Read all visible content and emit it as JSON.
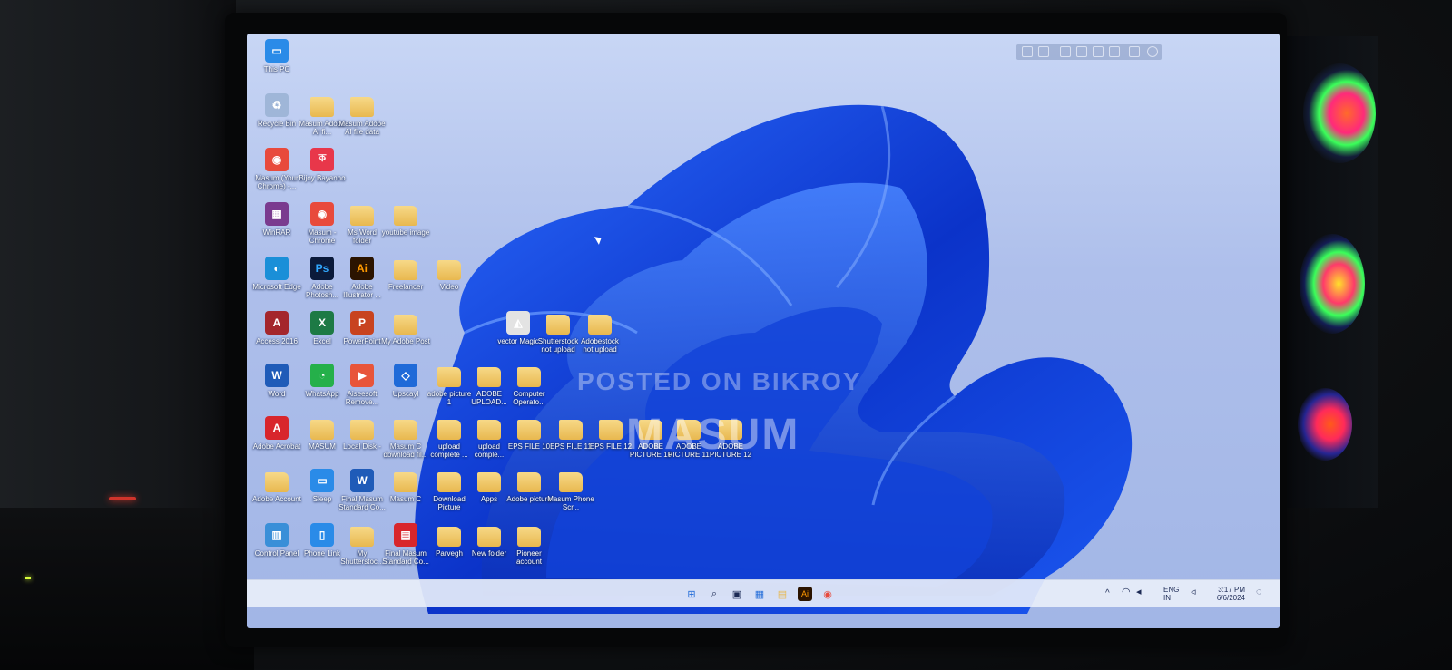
{
  "desktop": {
    "icons": [
      {
        "label": "This PC",
        "icon": "monitor-icon",
        "color": "#2a8be8"
      },
      {
        "label": "Recycle Bin",
        "icon": "recycle-bin-icon",
        "color": "#9fb6d8"
      },
      {
        "label": "Masum Adobe AI fi...",
        "icon": "folder-icon",
        "color": "#e8b84f"
      },
      {
        "label": "Masum Adobe AI file data",
        "icon": "folder-icon",
        "color": "#e8b84f"
      },
      {
        "label": "Masum (Your Chrome) -...",
        "icon": "chrome-icon",
        "color": "#e84a3c"
      },
      {
        "label": "Bijoy Bayanno",
        "icon": "bijoy-icon",
        "color": "#e8374a"
      },
      {
        "label": "WinRAR",
        "icon": "winrar-icon",
        "color": "#7a3b8f"
      },
      {
        "label": "Masum - Chrome",
        "icon": "chrome-icon",
        "color": "#e84a3c"
      },
      {
        "label": "Ms Word folder",
        "icon": "folder-icon",
        "color": "#e8b84f"
      },
      {
        "label": "youtube image",
        "icon": "folder-icon",
        "color": "#e8b84f"
      },
      {
        "label": "Microsoft Edge",
        "icon": "edge-icon",
        "color": "#1a8fd8"
      },
      {
        "label": "Adobe Photosh...",
        "icon": "photoshop-icon",
        "color": "#0b1a3a"
      },
      {
        "label": "Adobe Illustrator ...",
        "icon": "illustrator-icon",
        "color": "#2b1400"
      },
      {
        "label": "Freelancer",
        "icon": "folder-icon",
        "color": "#e8b84f"
      },
      {
        "label": "Video",
        "icon": "folder-icon",
        "color": "#e8b84f"
      },
      {
        "label": "Access 2016",
        "icon": "access-icon",
        "color": "#a4262c"
      },
      {
        "label": "Excel",
        "icon": "excel-icon",
        "color": "#1d7a45"
      },
      {
        "label": "PowerPoint",
        "icon": "powerpoint-icon",
        "color": "#c8431f"
      },
      {
        "label": "My Adobe Post",
        "icon": "folder-icon",
        "color": "#e8b84f"
      },
      {
        "label": "vector Magic",
        "icon": "vector-magic-icon",
        "color": "#e3e3e3"
      },
      {
        "label": "Shutterstock not upload",
        "icon": "folder-icon",
        "color": "#e8b84f"
      },
      {
        "label": "Adobestock not upload",
        "icon": "folder-icon",
        "color": "#e8b84f"
      },
      {
        "label": "Word",
        "icon": "word-icon",
        "color": "#1f5bb8"
      },
      {
        "label": "WhatsApp",
        "icon": "whatsapp-icon",
        "color": "#25b04a"
      },
      {
        "label": "Aiseesoft Remove...",
        "icon": "aiseesoft-icon",
        "color": "#e8553a"
      },
      {
        "label": "Upscayl",
        "icon": "upscayl-icon",
        "color": "#1f6ad8"
      },
      {
        "label": "adobe picture 1",
        "icon": "folder-icon",
        "color": "#e8b84f"
      },
      {
        "label": "ADOBE UPLOAD...",
        "icon": "folder-icon",
        "color": "#e8b84f"
      },
      {
        "label": "Computer Operato...",
        "icon": "folder-icon",
        "color": "#e8b84f"
      },
      {
        "label": "Adobe Acrobat",
        "icon": "acrobat-icon",
        "color": "#d8262c"
      },
      {
        "label": "MASUM",
        "icon": "folder-icon",
        "color": "#e8b84f"
      },
      {
        "label": "Local Disk -",
        "icon": "folder-icon",
        "color": "#e8b84f"
      },
      {
        "label": "Masum C download fil...",
        "icon": "folder-icon",
        "color": "#e8b84f"
      },
      {
        "label": "upload complete ...",
        "icon": "folder-icon",
        "color": "#e8b84f"
      },
      {
        "label": "upload comple...",
        "icon": "folder-icon",
        "color": "#e8b84f"
      },
      {
        "label": "EPS FILE 10",
        "icon": "folder-icon",
        "color": "#e8b84f"
      },
      {
        "label": "EPS FILE 11",
        "icon": "folder-icon",
        "color": "#e8b84f"
      },
      {
        "label": "EPS FILE 12",
        "icon": "folder-icon",
        "color": "#e8b84f"
      },
      {
        "label": "ADOBE PICTURE 10",
        "icon": "folder-icon",
        "color": "#e8b84f"
      },
      {
        "label": "ADOBE PICTURE 11",
        "icon": "folder-icon",
        "color": "#e8b84f"
      },
      {
        "label": "ADOBE PICTURE 12",
        "icon": "folder-icon",
        "color": "#e8b84f"
      },
      {
        "label": "Adobe Account",
        "icon": "folder-icon",
        "color": "#e8b84f"
      },
      {
        "label": "Sleep",
        "icon": "monitor-icon",
        "color": "#2a8be8"
      },
      {
        "label": "Final Masum Standard Co...",
        "icon": "word-doc-icon",
        "color": "#1f5bb8"
      },
      {
        "label": "Masum C",
        "icon": "folder-icon",
        "color": "#e8b84f"
      },
      {
        "label": "Download Picture",
        "icon": "folder-icon",
        "color": "#e8b84f"
      },
      {
        "label": "Apps",
        "icon": "folder-icon",
        "color": "#e8b84f"
      },
      {
        "label": "Adobe picture",
        "icon": "folder-icon",
        "color": "#e8b84f"
      },
      {
        "label": "Masum Phone Scr...",
        "icon": "folder-icon",
        "color": "#e8b84f"
      },
      {
        "label": "Control Panel",
        "icon": "control-panel-icon",
        "color": "#3a8fd8"
      },
      {
        "label": "Phone Link",
        "icon": "phone-link-icon",
        "color": "#2a8be8"
      },
      {
        "label": "My Shutterstoc...",
        "icon": "folder-icon",
        "color": "#e8b84f"
      },
      {
        "label": "Final Masum Standard Co...",
        "icon": "pdf-icon",
        "color": "#d8262c"
      },
      {
        "label": "Parvegh",
        "icon": "folder-icon",
        "color": "#e8b84f"
      },
      {
        "label": "New folder",
        "icon": "folder-icon",
        "color": "#e8b84f"
      },
      {
        "label": "Pioneer account",
        "icon": "folder-icon",
        "color": "#e8b84f"
      }
    ]
  },
  "watermark": {
    "posted": "POSTED ON BIKROY",
    "name": "MASUM"
  },
  "taskbar": {
    "apps": [
      {
        "name": "start",
        "icon": "windows-start-icon",
        "glyph": "⊞",
        "color": "#1f6ad8"
      },
      {
        "name": "search",
        "icon": "search-icon",
        "glyph": "⌕",
        "color": "#1c2a55"
      },
      {
        "name": "task-view",
        "icon": "task-view-icon",
        "glyph": "▣",
        "color": "#1c2a55"
      },
      {
        "name": "widgets",
        "icon": "widgets-icon",
        "glyph": "▦",
        "color": "#1f6ad8"
      },
      {
        "name": "file-explorer",
        "icon": "file-explorer-icon",
        "glyph": "▤",
        "color": "#e8b84f"
      },
      {
        "name": "illustrator",
        "icon": "illustrator-icon",
        "glyph": "Ai",
        "color": "#2b1400"
      },
      {
        "name": "chrome",
        "icon": "chrome-icon",
        "glyph": "◉",
        "color": "#e84a3c"
      }
    ],
    "tray": {
      "lang": "ENG",
      "lang2": "IN",
      "time": "3:17 PM",
      "date": "6/6/2024"
    }
  },
  "colors": {
    "wallpaper_bg": "#b7c8ef",
    "bloom_dark": "#0b33c9",
    "bloom_light": "#2d6dff",
    "accent": "#1f6ad8"
  }
}
